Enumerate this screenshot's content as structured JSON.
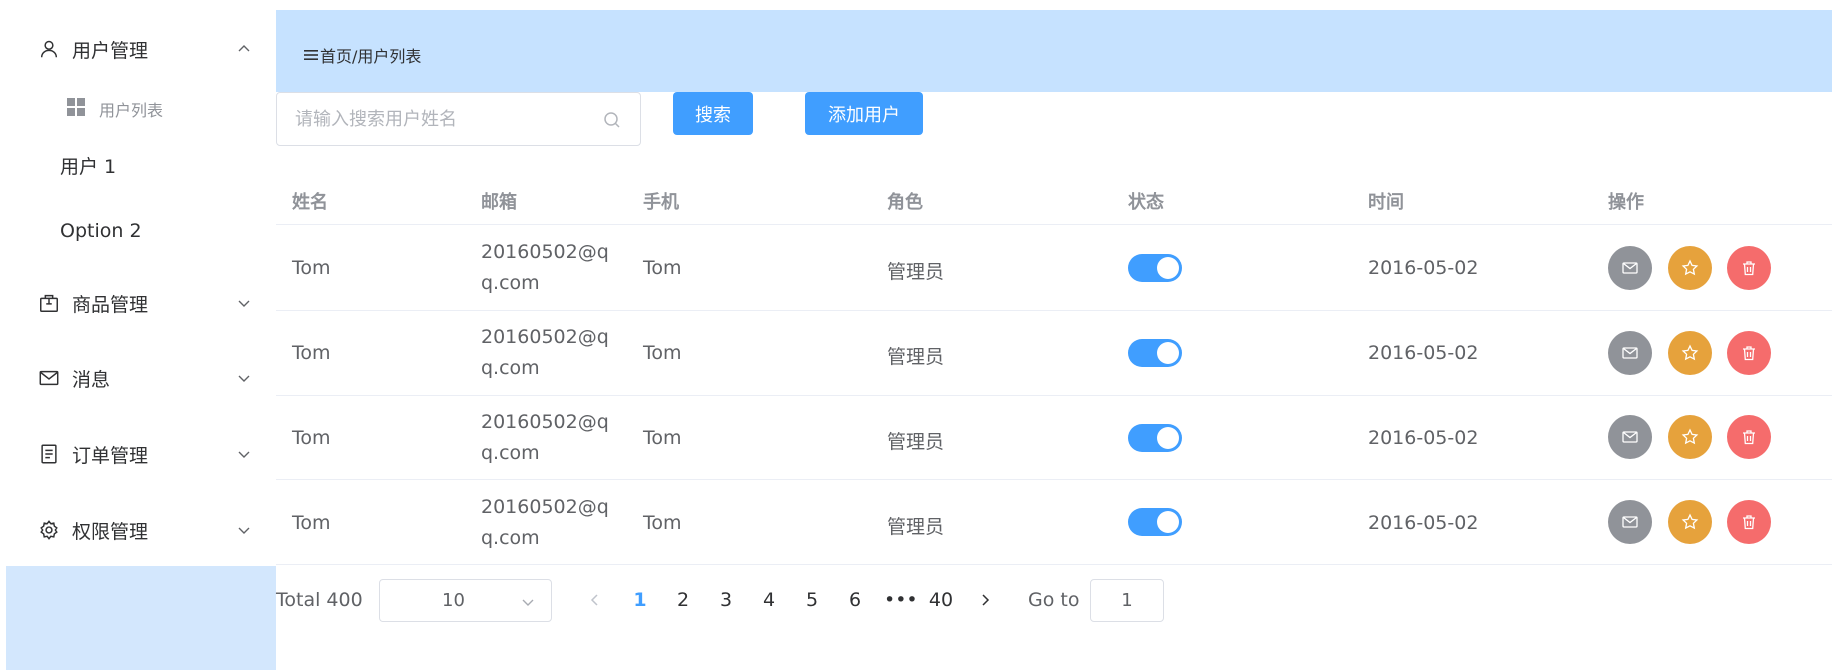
{
  "sidebar": {
    "menus": [
      {
        "label": "用户管理",
        "icon": "user-icon",
        "expanded": true
      },
      {
        "label": "商品管理",
        "icon": "goods-icon",
        "expanded": false
      },
      {
        "label": "消息",
        "icon": "message-icon",
        "expanded": false
      },
      {
        "label": "订单管理",
        "icon": "document-icon",
        "expanded": false
      },
      {
        "label": "权限管理",
        "icon": "setting-icon",
        "expanded": false
      }
    ],
    "submenu": {
      "label": "用户列表",
      "icon": "grid-icon"
    },
    "options": [
      "用户 1",
      "Option 2"
    ]
  },
  "header": {
    "breadcrumb": "首页/用户列表"
  },
  "toolbar": {
    "search_placeholder": "请输入搜索用户姓名",
    "search_value": "",
    "search_label": "搜索",
    "add_label": "添加用户"
  },
  "colors": {
    "primary": "#409eff",
    "header_bg": "#c6e2ff",
    "sidebar_fill": "#d3e7fd",
    "info": "#909399",
    "warning": "#e6a23c",
    "danger": "#f56c6c"
  },
  "table": {
    "columns": [
      "姓名",
      "邮箱",
      "手机",
      "角色",
      "状态",
      "时间",
      "操作"
    ],
    "rows": [
      {
        "name": "Tom",
        "email": "20160502@qq.com",
        "phone": "Tom",
        "role": "管理员",
        "status": true,
        "date": "2016-05-02"
      },
      {
        "name": "Tom",
        "email": "20160502@qq.com",
        "phone": "Tom",
        "role": "管理员",
        "status": true,
        "date": "2016-05-02"
      },
      {
        "name": "Tom",
        "email": "20160502@qq.com",
        "phone": "Tom",
        "role": "管理员",
        "status": true,
        "date": "2016-05-02"
      },
      {
        "name": "Tom",
        "email": "20160502@qq.com",
        "phone": "Tom",
        "role": "管理员",
        "status": true,
        "date": "2016-05-02"
      }
    ],
    "actions": [
      "message-icon",
      "star-icon",
      "delete-icon"
    ]
  },
  "pagination": {
    "total": "Total 400",
    "page_size": "10",
    "pages": [
      "1",
      "2",
      "3",
      "4",
      "5",
      "6",
      "•••",
      "40"
    ],
    "current": "1",
    "goto_label": "Go to",
    "goto_value": "1"
  }
}
